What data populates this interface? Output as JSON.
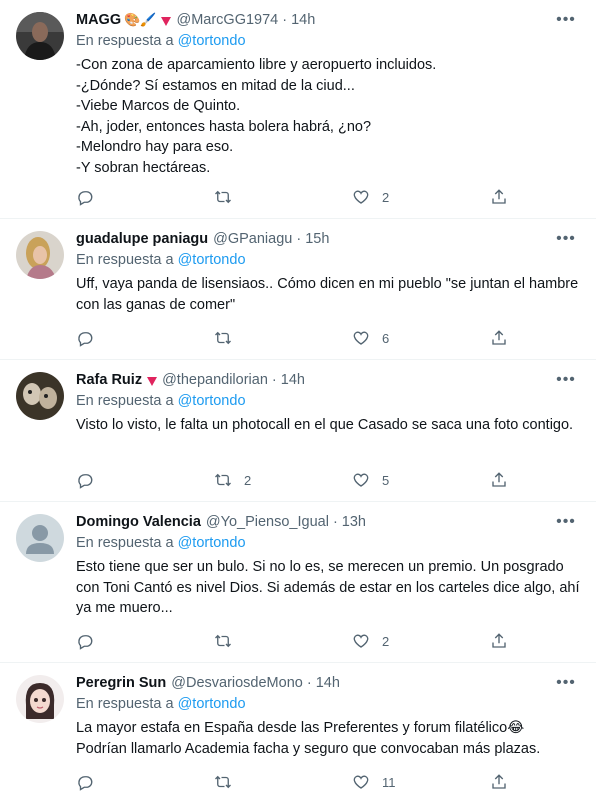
{
  "reply_prefix": "En respuesta a",
  "tweets": [
    {
      "name": "MAGG",
      "emoji": "🎨🖌️",
      "handle": "@MarcGG1974",
      "time": "14h",
      "reply_to": "@tortondo",
      "text": "-Con zona de aparcamiento libre y aeropuerto incluidos.\n-¿Dónde? Sí estamos en mitad de la ciud...\n-Viebe  Marcos de Quinto.\n-Ah, joder, entonces hasta bolera habrá, ¿no?\n-Melondro hay para eso.\n-Y sobran hectáreas.",
      "replies": "",
      "retweets": "",
      "likes": "2"
    },
    {
      "name": "guadalupe paniagu",
      "emoji": "",
      "handle": "@GPaniagu",
      "time": "15h",
      "reply_to": "@tortondo",
      "text": "Uff, vaya panda de lisensiaos.. Cómo dicen en mi pueblo \"se juntan el hambre con las ganas de comer\"",
      "replies": "",
      "retweets": "",
      "likes": "6"
    },
    {
      "name": "Rafa Ruiz",
      "emoji": "",
      "handle": "@thepandilorian",
      "time": "14h",
      "reply_to": "@tortondo",
      "text": "Visto lo visto, le falta un photocall en el que Casado se saca una foto contigo.",
      "replies": "",
      "retweets": "2",
      "likes": "5"
    },
    {
      "name": "Domingo Valencia",
      "emoji": "",
      "handle": "@Yo_Pienso_Igual",
      "time": "13h",
      "reply_to": "@tortondo",
      "text": "Esto tiene que ser un bulo. Si no lo es, se merecen un premio. Un posgrado con Toni Cantó es nivel Dios. Si además de estar en los carteles dice algo, ahí ya me muero...",
      "replies": "",
      "retweets": "",
      "likes": "2"
    },
    {
      "name": "Peregrin Sun",
      "emoji": "",
      "handle": "@DesvariosdeMono",
      "time": "14h",
      "reply_to": "@tortondo",
      "text": "La mayor estafa en España desde las Preferentes y forum filatélico😂\nPodrían llamarlo Academia facha y seguro que convocaban más plazas.",
      "replies": "",
      "retweets": "",
      "likes": "11"
    }
  ],
  "icons": {
    "reply": "reply-icon",
    "retweet": "retweet-icon",
    "like": "heart-icon",
    "share": "share-icon",
    "more": "more-icon"
  },
  "colors": {
    "link": "#1d9bf0",
    "muted": "#536471",
    "badge": "#e0245e",
    "divider": "#eff3f4"
  }
}
